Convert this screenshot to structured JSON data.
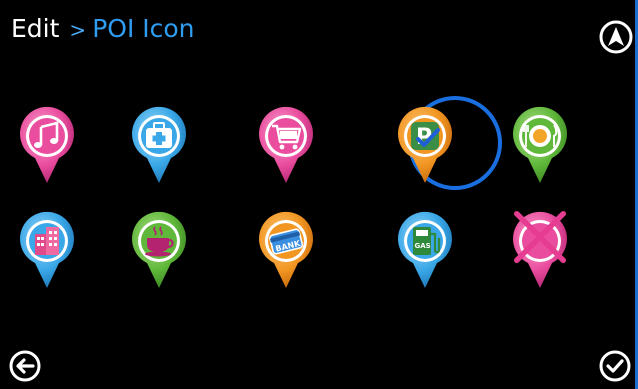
{
  "header": {
    "root": "Edit",
    "separator": ">",
    "current": "POI Icon"
  },
  "colors": {
    "background": "#000000",
    "accent_blue": "#2f9cf0",
    "selection_ring": "#1a6fe0",
    "pink": "#e8449a",
    "blue": "#3aa8e8",
    "orange": "#f29622",
    "green": "#5fb83a"
  },
  "icons": [
    {
      "name": "music-poi",
      "color": "pink",
      "glyph": "music-note-icon",
      "selected": false
    },
    {
      "name": "hospital-poi",
      "color": "blue",
      "glyph": "first-aid-kit-icon",
      "selected": false
    },
    {
      "name": "shopping-poi",
      "color": "pink",
      "glyph": "shopping-cart-icon",
      "selected": false
    },
    {
      "name": "parking-poi",
      "color": "orange",
      "glyph": "parking-checked-icon",
      "selected": true
    },
    {
      "name": "restaurant-poi",
      "color": "green",
      "glyph": "plate-cutlery-icon",
      "selected": false
    },
    {
      "name": "building-poi",
      "color": "blue",
      "glyph": "office-building-icon",
      "selected": false
    },
    {
      "name": "cafe-poi",
      "color": "green",
      "glyph": "coffee-cup-icon",
      "selected": false
    },
    {
      "name": "bank-poi",
      "color": "orange",
      "glyph": "bank-card-icon",
      "selected": false,
      "label": "BANK"
    },
    {
      "name": "gas-poi",
      "color": "blue",
      "glyph": "gas-pump-icon",
      "selected": false,
      "label": "GAS"
    },
    {
      "name": "no-icon-poi",
      "color": "pink",
      "glyph": "cross-out-icon",
      "selected": false
    }
  ],
  "buttons": {
    "navigate": "navigation-arrow-icon",
    "back": "back-arrow-icon",
    "confirm": "checkmark-icon"
  }
}
